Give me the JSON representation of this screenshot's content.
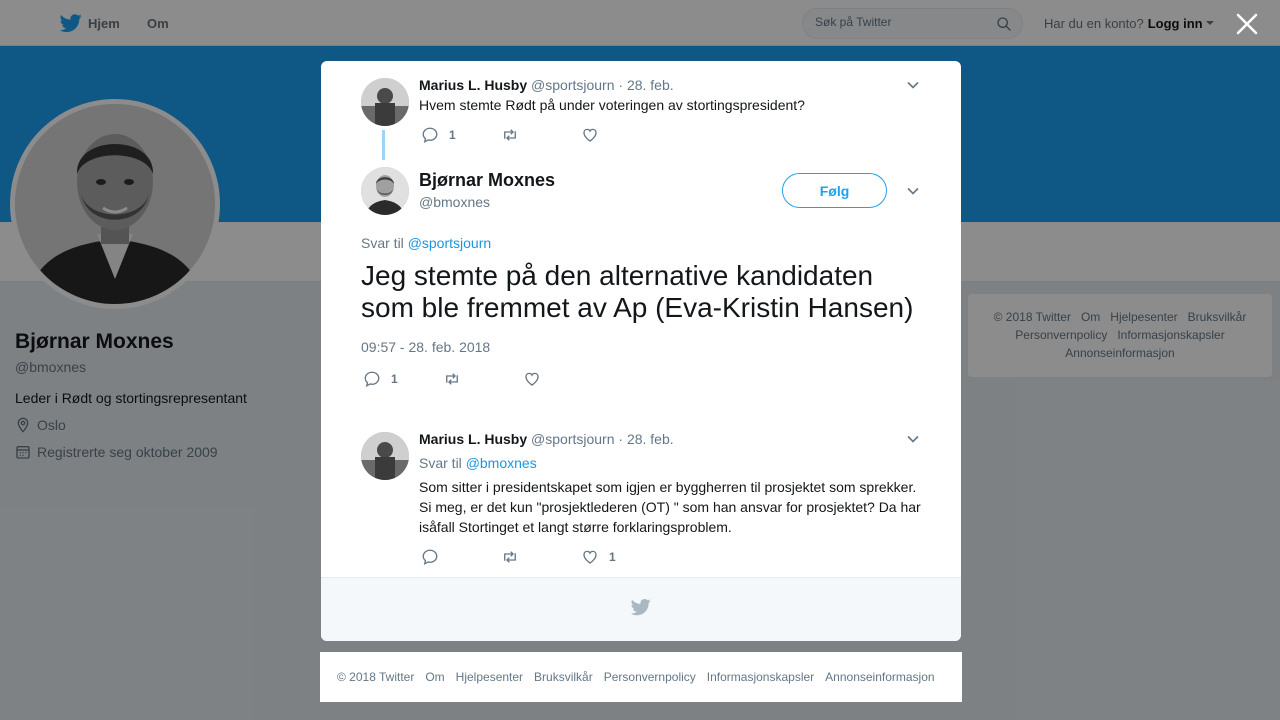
{
  "nav": {
    "home_label": "Hjem",
    "about_label": "Om",
    "search_placeholder": "Søk på Twitter",
    "account_question": "Har du en konto?",
    "login_label": "Logg inn"
  },
  "profile": {
    "name": "Bjørnar Moxnes",
    "handle": "@bmoxnes",
    "bio": "Leder i Rødt og stortingsrepresentant",
    "location": "Oslo",
    "joined": "Registrerte seg oktober 2009"
  },
  "side_footer": {
    "links": [
      "© 2018 Twitter",
      "Om",
      "Hjelpesenter",
      "Bruksvilkår",
      "Personvernpolicy",
      "Informasjonskapsler",
      "Annonseinformasjon"
    ]
  },
  "modal": {
    "parent_tweet": {
      "name": "Marius L. Husby",
      "handle": "@sportsjourn",
      "date": "· 28. feb.",
      "text": "Hvem stemte Rødt på under voteringen av stortingspresident?",
      "reply_count": "1"
    },
    "main_tweet": {
      "name": "Bjørnar Moxnes",
      "handle": "@bmoxnes",
      "follow_label": "Følg",
      "reply_to_prefix": "Svar til",
      "reply_to_handle": "@sportsjourn",
      "text": "Jeg stemte på den alternative kandidaten som ble fremmet av Ap (Eva-Kristin Hansen)",
      "timestamp": "09:57 - 28. feb. 2018",
      "reply_count": "1"
    },
    "reply_tweet": {
      "name": "Marius L. Husby",
      "handle": "@sportsjourn",
      "date": "· 28. feb.",
      "reply_to_prefix": "Svar til",
      "reply_to_handle": "@bmoxnes",
      "text": "Som sitter i presidentskapet som igjen er byggherren til prosjektet som sprekker. Si meg, er det kun \"prosjektlederen (OT) \" som han ansvar for prosjektet? Da har isåfall Stortinget et langt større forklaringsproblem.",
      "like_count": "1"
    }
  },
  "bottom_footer": {
    "links": [
      "© 2018 Twitter",
      "Om",
      "Hjelpesenter",
      "Bruksvilkår",
      "Personvernpolicy",
      "Informasjonskapsler",
      "Annonseinformasjon"
    ]
  },
  "colors": {
    "brand": "#1da1f2",
    "link": "#1b95e0",
    "muted": "#657786"
  }
}
